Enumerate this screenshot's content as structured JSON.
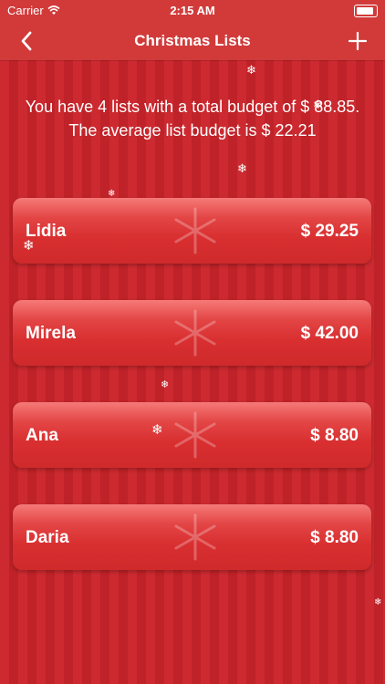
{
  "status": {
    "carrier": "Carrier",
    "time": "2:15 AM"
  },
  "nav": {
    "title": "Christmas Lists"
  },
  "summary": "You have 4 lists with a total budget of $ 88.85. The average list budget is $ 22.21",
  "lists": [
    {
      "name": "Lidia",
      "budget": "$ 29.25"
    },
    {
      "name": "Mirela",
      "budget": "$ 42.00"
    },
    {
      "name": "Ana",
      "budget": "$ 8.80"
    },
    {
      "name": "Daria",
      "budget": "$ 8.80"
    }
  ],
  "colors": {
    "background": "#c8262b",
    "bar": "#d23a3a",
    "card": "#e34545"
  }
}
